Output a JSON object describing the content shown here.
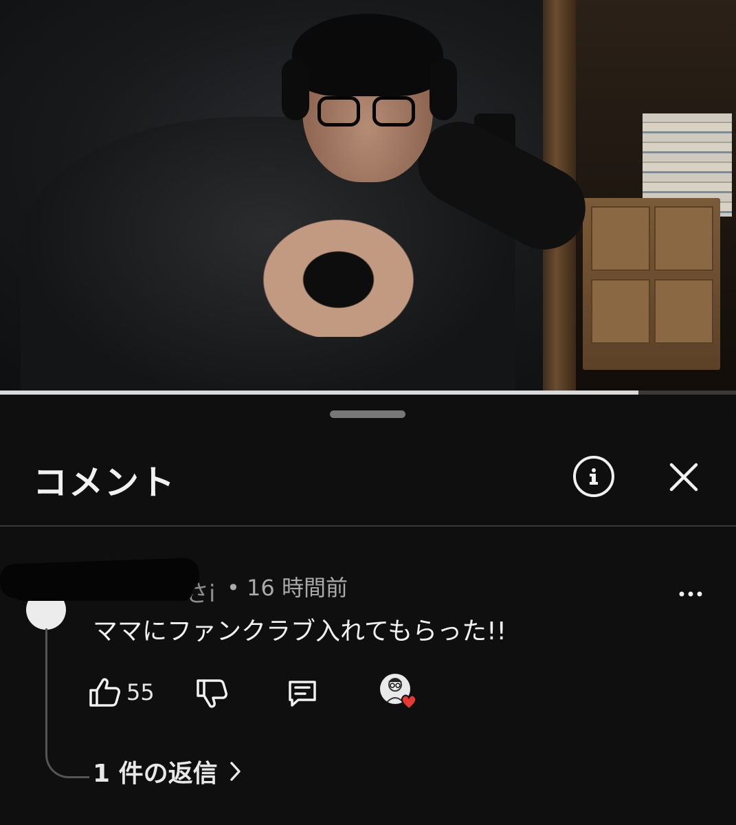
{
  "video": {
    "progress_fraction": 0.867
  },
  "comments_panel": {
    "title": "コメント",
    "info_icon": "info-icon",
    "close_icon": "close-icon"
  },
  "comment": {
    "author_visible_fragment": "さi",
    "separator": "•",
    "timestamp": "16 時間前",
    "text": "ママにファンクラブ入れてもらった!!",
    "like_count": "55",
    "icons": {
      "like": "thumbs-up-icon",
      "dislike": "thumbs-down-icon",
      "reply": "reply-icon",
      "more": "more-icon",
      "creator_heart": "heart-icon"
    },
    "heart_color": "#e53935",
    "replies_label": "1 件の返信"
  }
}
